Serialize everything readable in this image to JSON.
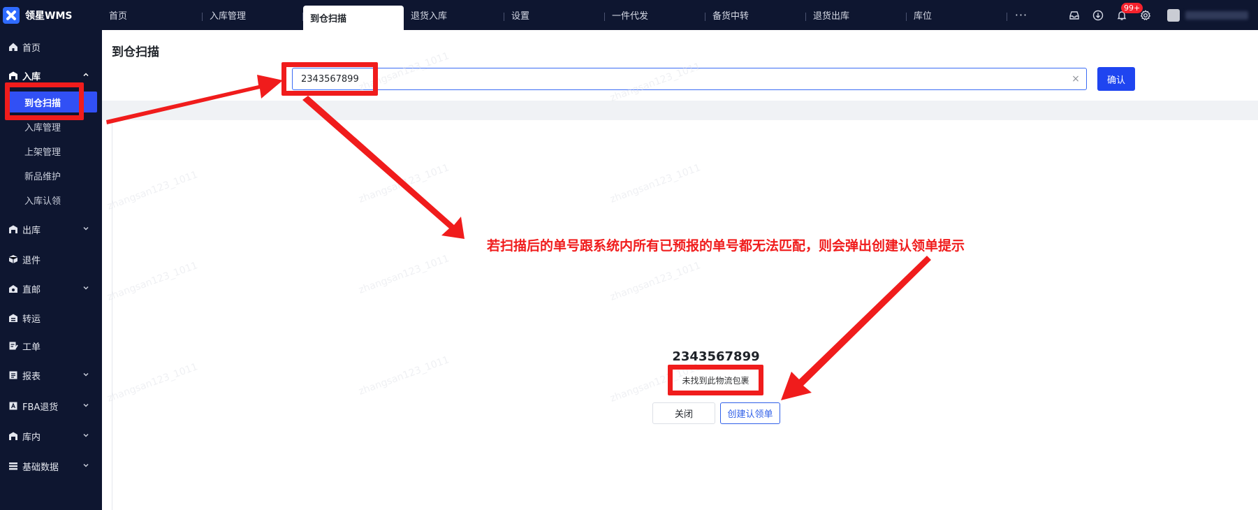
{
  "brand": {
    "name": "领星WMS"
  },
  "topnav": {
    "tabs": [
      {
        "label": "首页",
        "active": false
      },
      {
        "label": "入库管理",
        "active": false
      },
      {
        "label": "到仓扫描",
        "active": true
      },
      {
        "label": "退货入库",
        "active": false
      },
      {
        "label": "设置",
        "active": false
      },
      {
        "label": "一件代发",
        "active": false
      },
      {
        "label": "备货中转",
        "active": false
      },
      {
        "label": "退货出库",
        "active": false
      },
      {
        "label": "库位",
        "active": false
      }
    ],
    "more_label": "···",
    "notification_badge": "99+"
  },
  "sidebar": {
    "items": [
      {
        "label": "首页",
        "icon": "home-icon"
      },
      {
        "label": "入库",
        "icon": "warehouse-icon",
        "expanded": true
      },
      {
        "label": "出库",
        "icon": "warehouse-icon"
      },
      {
        "label": "退件",
        "icon": "package-icon"
      },
      {
        "label": "直邮",
        "icon": "mail-icon"
      },
      {
        "label": "转运",
        "icon": "transfer-icon"
      },
      {
        "label": "工单",
        "icon": "ticket-icon"
      },
      {
        "label": "报表",
        "icon": "report-icon"
      },
      {
        "label": "FBA退货",
        "icon": "fba-icon"
      },
      {
        "label": "库内",
        "icon": "warehouse-icon"
      },
      {
        "label": "基础数据",
        "icon": "data-icon"
      }
    ],
    "subitems": [
      {
        "label": "到仓扫描",
        "active": true
      },
      {
        "label": "入库管理",
        "active": false
      },
      {
        "label": "上架管理",
        "active": false
      },
      {
        "label": "新品维护",
        "active": false
      },
      {
        "label": "入库认领",
        "active": false
      }
    ]
  },
  "main": {
    "title": "到仓扫描",
    "scan_input": {
      "value": "2343567899"
    },
    "confirm_label": "确认",
    "result": {
      "number": "2343567899",
      "message": "未找到此物流包裹",
      "close_label": "关闭",
      "create_label": "创建认领单"
    }
  },
  "annotation": {
    "text": "若扫描后的单号跟系统内所有已预报的单号都无法匹配，则会弹出创建认领单提示"
  },
  "watermark": {
    "text": "zhangsan123_1011"
  },
  "colors": {
    "nav_bg": "#0e1630",
    "accent": "#1f45f0",
    "highlight": "#f01c1c",
    "active_sub": "#3150f5"
  }
}
